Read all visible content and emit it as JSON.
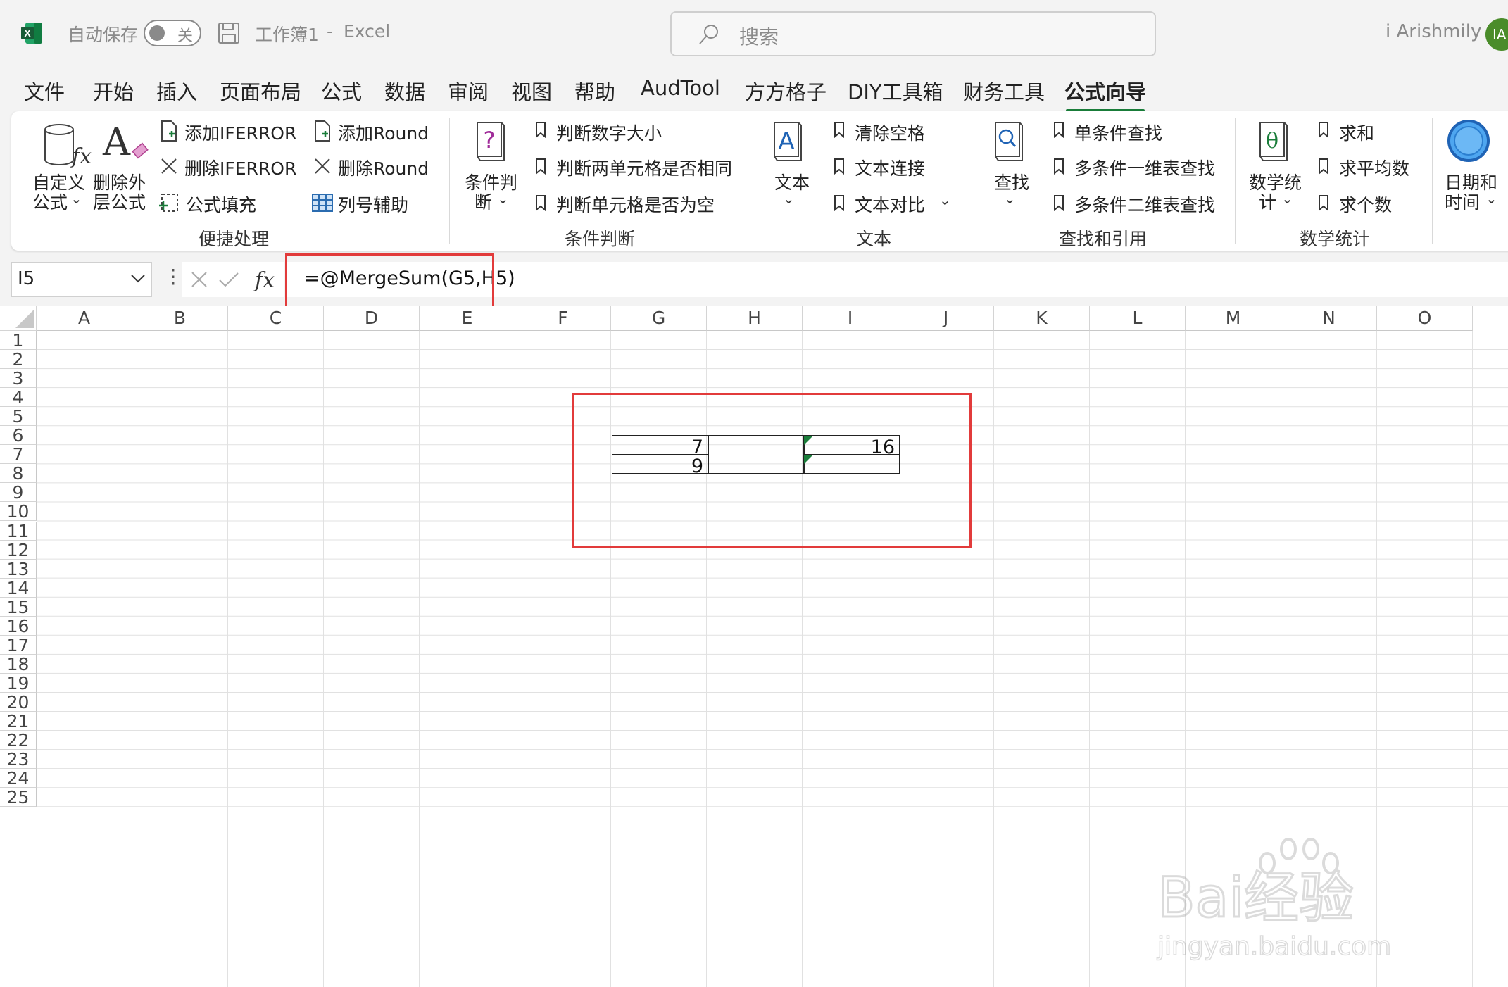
{
  "titlebar": {
    "autosave_label": "自动保存",
    "autosave_state": "关",
    "document_title": "工作簿1",
    "separator": "-",
    "app_name": "Excel",
    "search_placeholder": "搜索",
    "user_name": "i Arishmily",
    "avatar_initials": "IA"
  },
  "menu": {
    "items": [
      "文件",
      "开始",
      "插入",
      "页面布局",
      "公式",
      "数据",
      "审阅",
      "视图",
      "帮助",
      "AudTool",
      "方方格子",
      "DIY工具箱",
      "财务工具",
      "公式向导"
    ],
    "active": "公式向导"
  },
  "ribbon": {
    "quick": {
      "custom_formula": [
        "自定义",
        "公式"
      ],
      "remove_outer": [
        "删除外",
        "层公式"
      ],
      "add_iferror": "添加IFERROR",
      "del_iferror": "删除IFERROR",
      "fill_formula": "公式填充",
      "add_round": "添加Round",
      "del_round": "删除Round",
      "col_helper": "列号辅助",
      "group_label": "便捷处理"
    },
    "condition": {
      "button": [
        "条件判",
        "断"
      ],
      "items": [
        "判断数字大小",
        "判断两单元格是否相同",
        "判断单元格是否为空"
      ],
      "group_label": "条件判断"
    },
    "text": {
      "button": "文本",
      "items": [
        "清除空格",
        "文本连接",
        "文本对比"
      ],
      "group_label": "文本"
    },
    "lookup": {
      "button": "查找",
      "items": [
        "单条件查找",
        "多条件一维表查找",
        "多条件二维表查找"
      ],
      "group_label": "查找和引用"
    },
    "math": {
      "button": [
        "数学统",
        "计"
      ],
      "items": [
        "求和",
        "求平均数",
        "求个数"
      ],
      "group_label": "数学统计"
    },
    "datetime": {
      "button": [
        "日期和",
        "时间"
      ]
    }
  },
  "formula_bar": {
    "name_box": "I5",
    "formula": "=@MergeSum(G5,H5)"
  },
  "grid": {
    "columns": [
      "A",
      "B",
      "C",
      "D",
      "E",
      "F",
      "G",
      "H",
      "I",
      "J",
      "K",
      "L",
      "M",
      "N",
      "O"
    ],
    "rows": [
      "1",
      "2",
      "3",
      "4",
      "5",
      "6",
      "7",
      "8",
      "9",
      "10",
      "11",
      "12",
      "13",
      "14",
      "15",
      "16",
      "17",
      "18",
      "19",
      "20",
      "21",
      "22",
      "23",
      "24",
      "25"
    ],
    "cells": {
      "G5": "7",
      "G6": "9",
      "I5": "16"
    }
  },
  "watermark": {
    "brand": "Bai经验",
    "url": "jingyan.baidu.com"
  },
  "colors": {
    "accent": "#1a7d3a",
    "highlight": "#e23b3b"
  }
}
